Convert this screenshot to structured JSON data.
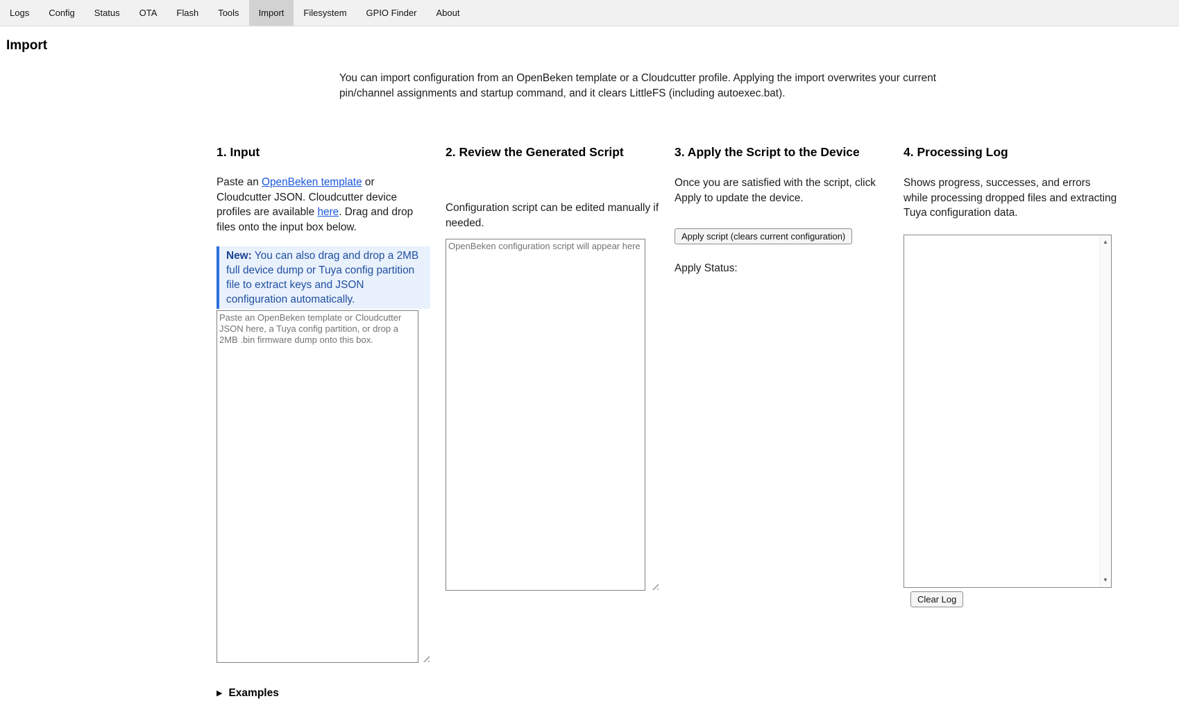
{
  "nav": {
    "active_tab": "Import",
    "tabs": [
      {
        "label": "Logs"
      },
      {
        "label": "Config"
      },
      {
        "label": "Status"
      },
      {
        "label": "OTA"
      },
      {
        "label": "Flash"
      },
      {
        "label": "Tools"
      },
      {
        "label": "Import"
      },
      {
        "label": "Filesystem"
      },
      {
        "label": "GPIO Finder"
      },
      {
        "label": "About"
      }
    ]
  },
  "page": {
    "title": "Import",
    "intro": "You can import configuration from an OpenBeken template or a Cloudcutter profile. Applying the import overwrites your current pin/channel assignments and startup command, and it clears LittleFS (including autoexec.bat)."
  },
  "input_column": {
    "heading": "1. Input",
    "desc_part1": "Paste an ",
    "desc_link1": "OpenBeken template",
    "desc_part2": " or Cloudcutter JSON. Cloudcutter device profiles are available ",
    "desc_link2": "here",
    "desc_part3": ". Drag and drop files onto the input box below.",
    "note_label": "New:",
    "note_text": " You can also drag and drop a 2MB full device dump or Tuya config partition file to extract keys and JSON configuration automatically.",
    "textarea_value": "",
    "textarea_placeholder": "Paste an OpenBeken template or Cloudcutter JSON here, a Tuya config partition, or drop a 2MB .bin firmware dump onto this box.",
    "examples_icon": "▶",
    "examples_label": "Examples"
  },
  "review_column": {
    "heading": "2. Review the Generated Script",
    "desc": "Configuration script can be edited manually if needed.",
    "textarea_value": "",
    "textarea_placeholder": "OpenBeken configuration script will appear here"
  },
  "apply_column": {
    "heading": "3. Apply the Script to the Device",
    "desc": "Once you are satisfied with the script, click Apply to update the device.",
    "apply_button_label": "Apply script (clears current configuration)",
    "status_label": "Apply Status:"
  },
  "log_column": {
    "heading": "4. Processing Log",
    "desc": "Shows progress, successes, and errors while processing dropped files and extracting Tuya configuration data.",
    "log_content": "",
    "scroll_up_icon": "▲",
    "scroll_down_icon": "▼",
    "clear_button_label": "Clear Log"
  },
  "colors": {
    "link": "#1a56db",
    "note_background": "#e9f1fd",
    "note_border": "#2f6fdb",
    "note_text": "#1f4e9e",
    "tab_bar_background": "#f1f1f1",
    "active_tab_background": "#d2d2d2"
  }
}
